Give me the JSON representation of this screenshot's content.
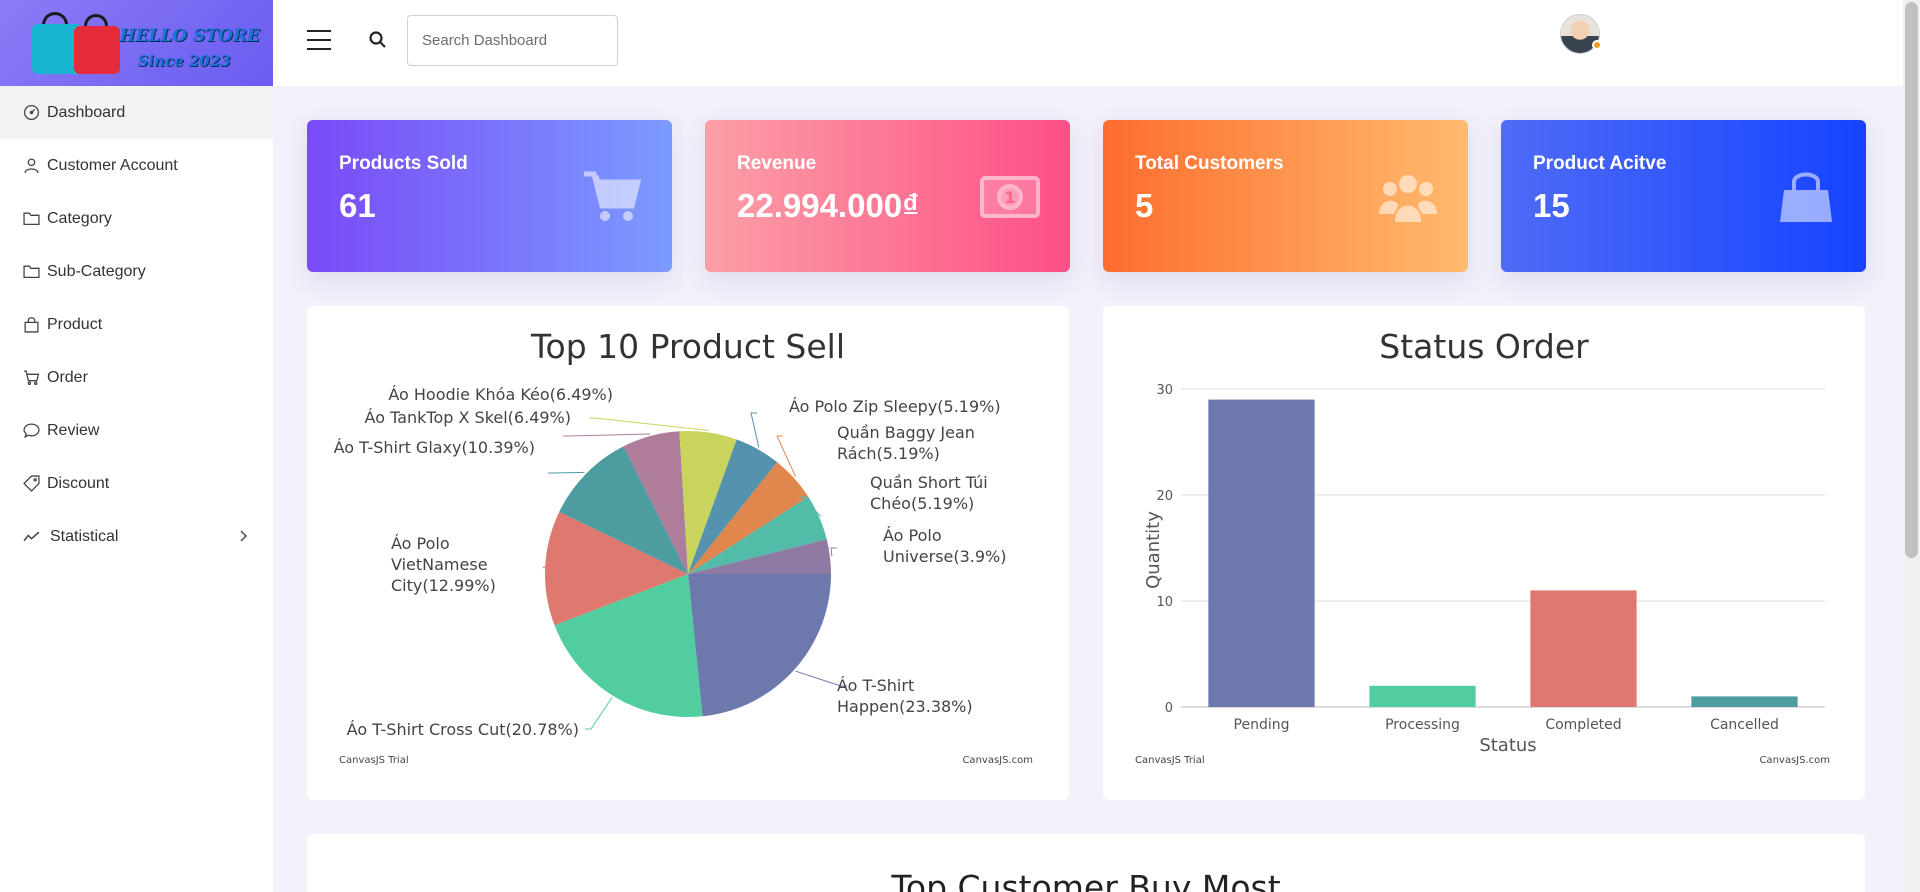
{
  "logo": {
    "line1": "HELLO STORE",
    "line2": "Since 2023"
  },
  "sidebar": {
    "items": [
      {
        "label": "Dashboard",
        "icon": "gauge-icon",
        "active": true
      },
      {
        "label": "Customer Account",
        "icon": "user-icon"
      },
      {
        "label": "Category",
        "icon": "folder-icon"
      },
      {
        "label": "Sub-Category",
        "icon": "folder-icon"
      },
      {
        "label": "Product",
        "icon": "bag-icon"
      },
      {
        "label": "Order",
        "icon": "cart-icon"
      },
      {
        "label": "Review",
        "icon": "chat-icon"
      },
      {
        "label": "Discount",
        "icon": "tag-icon"
      },
      {
        "label": "Statistical",
        "icon": "trend-icon",
        "has_submenu": true
      }
    ]
  },
  "header": {
    "search_placeholder": "Search Dashboard",
    "search_value": ""
  },
  "cards": [
    {
      "label": "Products Sold",
      "value": "61",
      "icon": "cart-icon"
    },
    {
      "label": "Revenue",
      "value": "22.994.000₫",
      "icon": "money-icon"
    },
    {
      "label": "Total Customers",
      "value": "5",
      "icon": "users-icon"
    },
    {
      "label": "Product Acitve",
      "value": "15",
      "icon": "bag-icon"
    }
  ],
  "pie_watermark_left": "CanvasJS Trial",
  "pie_watermark_right": "CanvasJS.com",
  "bar_watermark_left": "CanvasJS Trial",
  "bar_watermark_right": "CanvasJS.com",
  "chart_data": [
    {
      "type": "pie",
      "title": "Top 10 Product Sell",
      "slices": [
        {
          "label": "Áo T-Shirt Happen(23.38%)",
          "value": 23.38,
          "color": "#6d78ad"
        },
        {
          "label": "Áo T-Shirt Cross Cut(20.78%)",
          "value": 20.78,
          "color": "#51cda0"
        },
        {
          "label": "Áo Polo VietNamese City(12.99%)",
          "value": 12.99,
          "color": "#df7970"
        },
        {
          "label": "Áo T-Shirt Glaxy(10.39%)",
          "value": 10.39,
          "color": "#4c9ca0"
        },
        {
          "label": "Áo TankTop X Skel(6.49%)",
          "value": 6.49,
          "color": "#ae7d99"
        },
        {
          "label": "Áo Hoodie Khóa Kéo(6.49%)",
          "value": 6.49,
          "color": "#c9d45c"
        },
        {
          "label": "Áo Polo Zip Sleepy(5.19%)",
          "value": 5.19,
          "color": "#5592ad"
        },
        {
          "label": "Quần Baggy Jean Rách(5.19%)",
          "value": 5.19,
          "color": "#df874d"
        },
        {
          "label": "Quần Short Túi Chéo(5.19%)",
          "value": 5.19,
          "color": "#52bca8"
        },
        {
          "label": "Áo Polo Universe(3.9%)",
          "value": 3.9,
          "color": "#8e7aa3"
        }
      ]
    },
    {
      "type": "bar",
      "title": "Status Order",
      "xlabel": "Status",
      "ylabel": "Quantity",
      "categories": [
        "Pending",
        "Processing",
        "Completed",
        "Cancelled"
      ],
      "values": [
        29,
        2,
        11,
        1
      ],
      "colors": [
        "#6d78ad",
        "#51cda0",
        "#df7970",
        "#4c9ca0"
      ],
      "ylim": [
        0,
        30
      ],
      "yticks": [
        0,
        10,
        20,
        30
      ],
      "grid": true
    }
  ],
  "bottom_section": {
    "title": "Top Customer Buy Most"
  }
}
